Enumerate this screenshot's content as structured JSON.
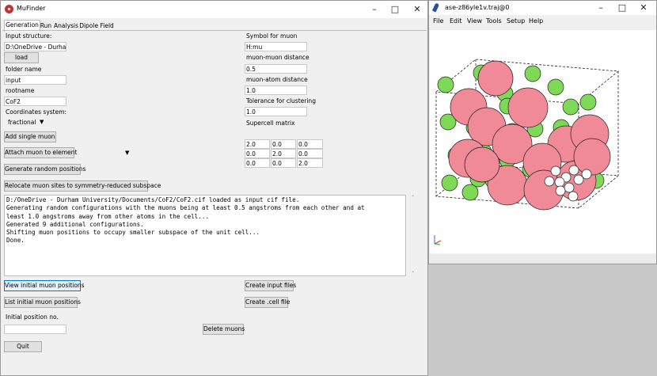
{
  "mufinder": {
    "title": "MuFinder",
    "tabs": [
      "Generation",
      "Run",
      "Analysis",
      "Dipole Field"
    ],
    "input_structure_label": "Input structure:",
    "input_structure_value": "D:\\OneDrive - Durham",
    "load_label": "load",
    "folder_name_label": "folder name",
    "folder_name_value": "input",
    "rootname_label": "rootname",
    "rootname_value": "CoF2",
    "coord_system_label": "Coordinates system:",
    "coord_system_value": "fractional",
    "add_single_muon_label": "Add single muon",
    "attach_muon_label": "Attach muon to element",
    "generate_random_label": "Generate random positions",
    "relocate_label": "Relocate muon sites to symmetry-reduced subspace",
    "symbol_label": "Symbol for muon",
    "symbol_value": "H:mu",
    "mm_dist_label": "muon-muon distance",
    "mm_dist_value": "0.5",
    "ma_dist_label": "muon-atom distance",
    "ma_dist_value": "1.0",
    "tol_label": "Tolerance for clustering",
    "tol_value": "1.0",
    "supercell_label": "Supercell matrix",
    "supercell": [
      [
        "2.0",
        "0.0",
        "0.0"
      ],
      [
        "0.0",
        "2.0",
        "0.0"
      ],
      [
        "0.0",
        "0.0",
        "2.0"
      ]
    ],
    "console_lines": [
      "D:/OneDrive - Durham University/Documents/CoF2/CoF2.cif loaded as input cif file.",
      "Generating random configurations with the muons being at least 0.5 angstroms from each other and at",
      "least 1.0 angstroms away from other atoms in the cell...",
      "Generated 9 additional configurations.",
      "Shifting muon positions to occupy smaller subspace of the unit cell...",
      "Done."
    ],
    "view_initial_label": "View initial muon positions",
    "list_initial_label": "List initial muon positions",
    "create_input_label": "Create input files",
    "create_cell_label": "Create .cell file",
    "initial_pos_label": "Initial position no.",
    "initial_pos_value": "",
    "delete_muons_label": "Delete muons",
    "quit_label": "Quit"
  },
  "ase": {
    "title": "ase-z86yle1v.traj@0",
    "menu": [
      "File",
      "Edit",
      "View",
      "Tools",
      "Setup",
      "Help"
    ],
    "colors": {
      "big_atom": "#f08a96",
      "small_atom": "#7ed957",
      "muon": "#ffffff"
    }
  }
}
